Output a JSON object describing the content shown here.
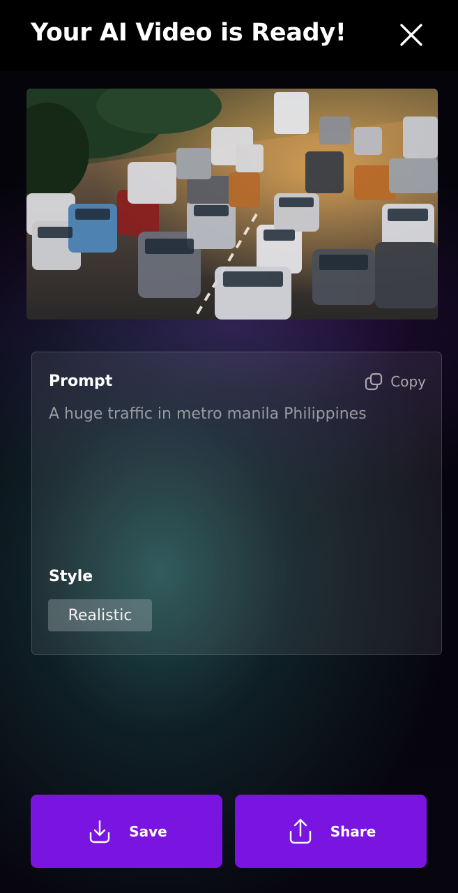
{
  "header": {
    "title": "Your AI Video is Ready!",
    "close_icon": "close-icon"
  },
  "preview": {
    "description_icon": "video-thumbnail"
  },
  "card": {
    "prompt_label": "Prompt",
    "copy_label": "Copy",
    "copy_icon": "copy-icon",
    "prompt_text": "A huge traffic in metro manila Philippines",
    "style_label": "Style",
    "style_value": "Realistic"
  },
  "actions": {
    "save_label": "Save",
    "save_icon": "download-icon",
    "share_label": "Share",
    "share_icon": "share-icon"
  },
  "colors": {
    "accent": "#7a14e0",
    "background": "#05040a"
  }
}
